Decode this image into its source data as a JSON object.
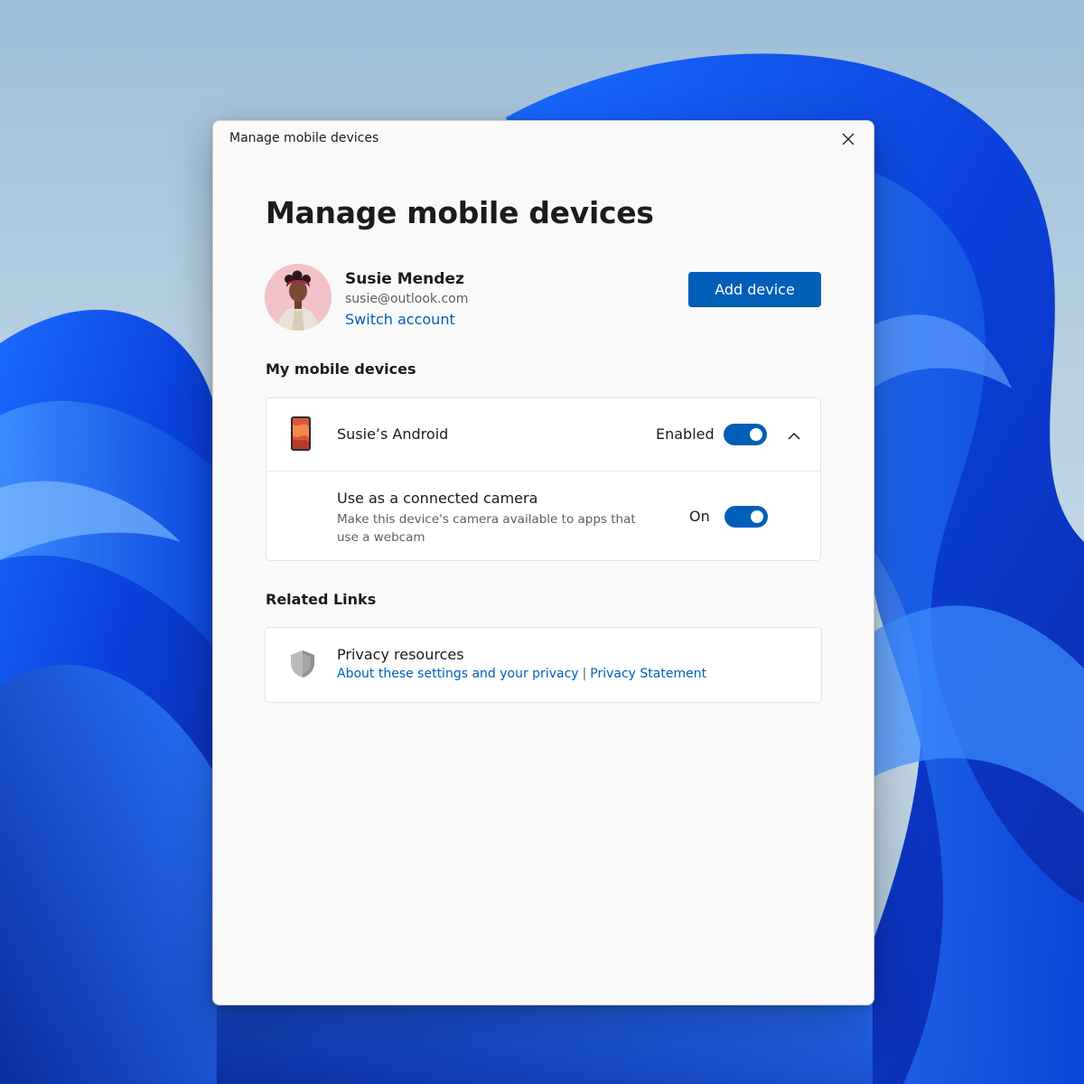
{
  "window": {
    "title": "Manage mobile devices"
  },
  "page": {
    "title": "Manage mobile devices"
  },
  "account": {
    "name": "Susie Mendez",
    "email": "susie@outlook.com",
    "switch_label": "Switch account",
    "add_device_label": "Add device"
  },
  "devices_section": {
    "title": "My mobile devices",
    "device": {
      "name": "Susie’s Android",
      "status_label": "Enabled",
      "enabled": true,
      "expanded": true
    },
    "camera_setting": {
      "title": "Use as a connected camera",
      "description": "Make this device's camera available to apps that use a webcam",
      "state_label": "On",
      "on": true
    }
  },
  "related_section": {
    "title": "Related Links",
    "privacy": {
      "title": "Privacy resources",
      "link1": "About these settings and your privacy",
      "separator": "|",
      "link2": "Privacy Statement"
    }
  },
  "icons": {
    "close": "close-icon",
    "chevron": "chevron-up-icon",
    "phone": "phone-icon",
    "shield": "shield-icon"
  },
  "colors": {
    "accent": "#005fb8",
    "dialog_bg": "#f9f9f9",
    "card_bg": "#ffffff"
  }
}
